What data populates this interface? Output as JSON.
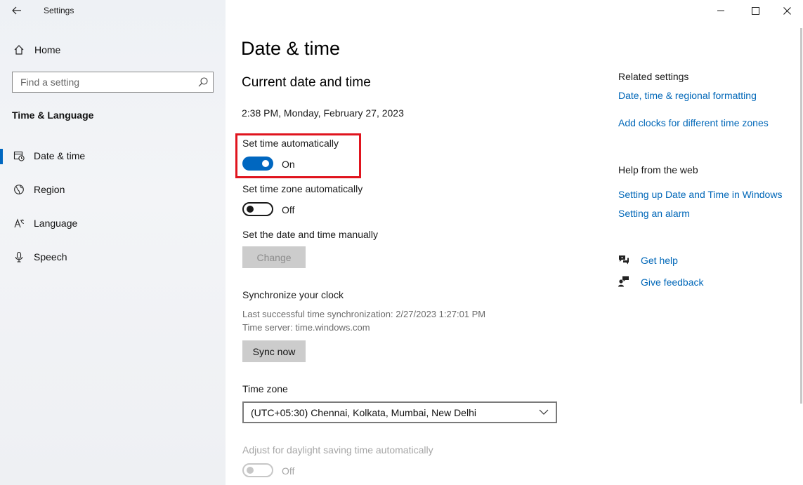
{
  "window": {
    "app_title": "Settings"
  },
  "sidebar": {
    "home_label": "Home",
    "search_placeholder": "Find a setting",
    "section_title": "Time & Language",
    "items": [
      {
        "label": "Date & time",
        "icon": "date-time-icon",
        "active": true
      },
      {
        "label": "Region",
        "icon": "globe-icon",
        "active": false
      },
      {
        "label": "Language",
        "icon": "language-icon",
        "active": false
      },
      {
        "label": "Speech",
        "icon": "microphone-icon",
        "active": false
      }
    ]
  },
  "main": {
    "page_title": "Date & time",
    "section_title": "Current date and time",
    "current_datetime": "2:38 PM, Monday, February 27, 2023",
    "set_time_auto": {
      "label": "Set time automatically",
      "state": "On"
    },
    "set_zone_auto": {
      "label": "Set time zone automatically",
      "state": "Off"
    },
    "manual": {
      "label": "Set the date and time manually",
      "button": "Change"
    },
    "sync": {
      "title": "Synchronize your clock",
      "last_sync": "Last successful time synchronization: 2/27/2023 1:27:01 PM",
      "server": "Time server: time.windows.com",
      "button": "Sync now"
    },
    "time_zone": {
      "label": "Time zone",
      "value": "(UTC+05:30) Chennai, Kolkata, Mumbai, New Delhi"
    },
    "daylight": {
      "label": "Adjust for daylight saving time automatically",
      "state": "Off"
    }
  },
  "related": {
    "title": "Related settings",
    "links": [
      "Date, time & regional formatting",
      "Add clocks for different time zones"
    ]
  },
  "help": {
    "title": "Help from the web",
    "links": [
      "Setting up Date and Time in Windows",
      "Setting an alarm"
    ],
    "get_help": "Get help",
    "give_feedback": "Give feedback"
  },
  "colors": {
    "accent": "#0067c0",
    "link": "#0067b8",
    "highlight_box": "#e0141e"
  }
}
